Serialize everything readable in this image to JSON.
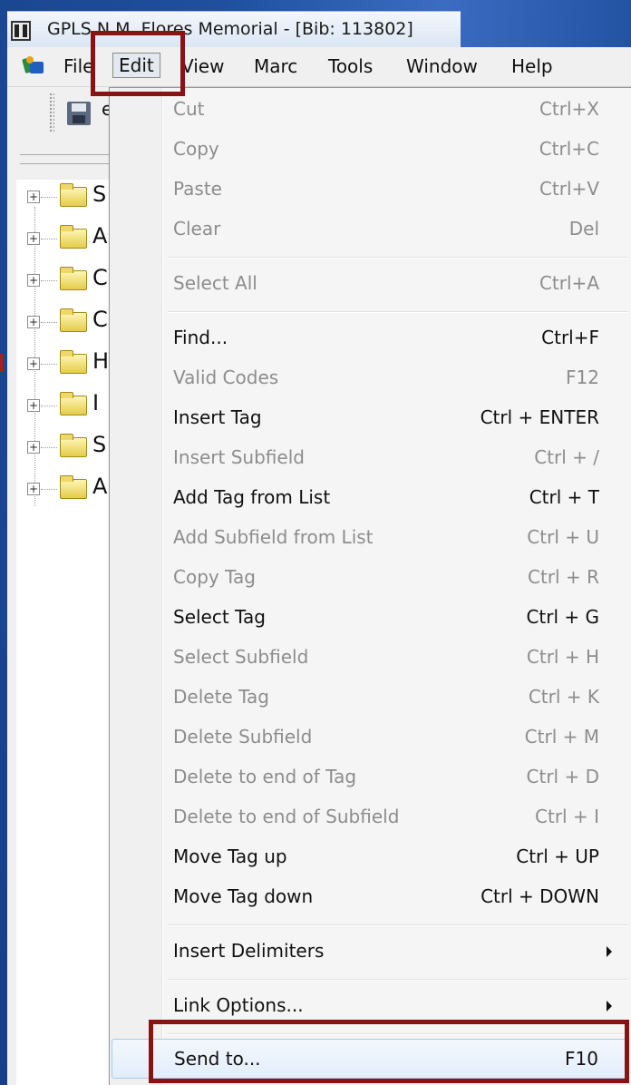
{
  "window": {
    "title": "GPLS N.M. Flores Memorial - [Bib: 113802]"
  },
  "menubar": {
    "items": [
      {
        "label": "File",
        "active": false
      },
      {
        "label": "Edit",
        "active": true
      },
      {
        "label": "View",
        "active": false
      },
      {
        "label": "Marc",
        "active": false
      },
      {
        "label": "Tools",
        "active": false
      },
      {
        "label": "Window",
        "active": false
      },
      {
        "label": "Help",
        "active": false
      }
    ]
  },
  "toolbar": {
    "partial_text": "e"
  },
  "tree": {
    "items": [
      {
        "label": "S"
      },
      {
        "label": "A"
      },
      {
        "label": "C"
      },
      {
        "label": "C"
      },
      {
        "label": "H"
      },
      {
        "label": "I"
      },
      {
        "label": "S"
      },
      {
        "label": "A"
      }
    ]
  },
  "edit_menu": {
    "items": [
      {
        "label": "Cut",
        "shortcut": "Ctrl+X",
        "enabled": false
      },
      {
        "label": "Copy",
        "shortcut": "Ctrl+C",
        "enabled": false
      },
      {
        "label": "Paste",
        "shortcut": "Ctrl+V",
        "enabled": false
      },
      {
        "label": "Clear",
        "shortcut": "Del",
        "enabled": false
      },
      {
        "label": "Select All",
        "shortcut": "Ctrl+A",
        "enabled": false
      },
      {
        "label": "Find...",
        "shortcut": "Ctrl+F",
        "enabled": true
      },
      {
        "label": "Valid Codes",
        "shortcut": "F12",
        "enabled": false
      },
      {
        "label": "Insert Tag",
        "shortcut": "Ctrl + ENTER",
        "enabled": true
      },
      {
        "label": "Insert Subfield",
        "shortcut": "Ctrl + /",
        "enabled": false
      },
      {
        "label": "Add Tag from List",
        "shortcut": "Ctrl + T",
        "enabled": true
      },
      {
        "label": "Add Subfield from List",
        "shortcut": "Ctrl + U",
        "enabled": false
      },
      {
        "label": "Copy Tag",
        "shortcut": "Ctrl + R",
        "enabled": false
      },
      {
        "label": "Select Tag",
        "shortcut": "Ctrl + G",
        "enabled": true
      },
      {
        "label": "Select Subfield",
        "shortcut": "Ctrl + H",
        "enabled": false
      },
      {
        "label": "Delete Tag",
        "shortcut": "Ctrl + K",
        "enabled": false
      },
      {
        "label": "Delete Subfield",
        "shortcut": "Ctrl + M",
        "enabled": false
      },
      {
        "label": "Delete to end of Tag",
        "shortcut": "Ctrl + D",
        "enabled": false
      },
      {
        "label": "Delete to end of Subfield",
        "shortcut": "Ctrl + I",
        "enabled": false
      },
      {
        "label": "Move Tag up",
        "shortcut": "Ctrl + UP",
        "enabled": true
      },
      {
        "label": "Move Tag down",
        "shortcut": "Ctrl + DOWN",
        "enabled": true
      },
      {
        "label": "Insert Delimiters",
        "submenu": true,
        "enabled": true
      },
      {
        "label": "Link Options...",
        "submenu": true,
        "enabled": true
      },
      {
        "label": "Send to...",
        "shortcut": "F10",
        "enabled": true,
        "hovered": true
      }
    ]
  },
  "colors": {
    "annotation_box": "#8b1212",
    "slide_background": "#1f4f9e",
    "menu_background": "#f5f5f5",
    "disabled_text": "#8d8d8d"
  },
  "icons": {
    "app": "app-icon",
    "file_menu": "colorful-app-icon",
    "save": "floppy-save-icon",
    "folder": "folder-icon",
    "expander": "plus-expander-icon",
    "submenu": "submenu-arrow-icon"
  }
}
